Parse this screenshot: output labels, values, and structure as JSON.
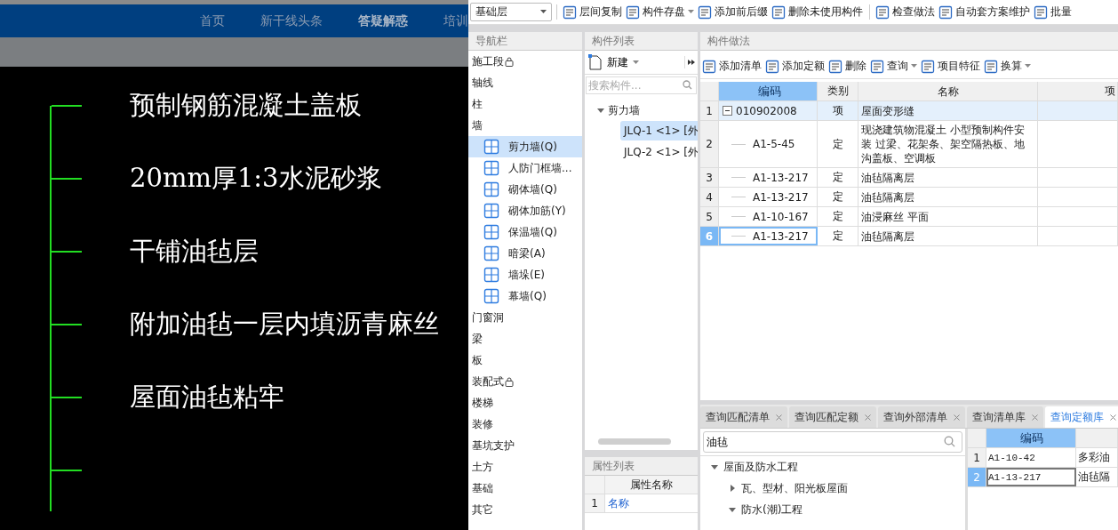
{
  "web_header": {
    "nav_links": [
      {
        "label": "首页",
        "selected": false
      },
      {
        "label": "新干线头条",
        "selected": false
      },
      {
        "label": "答疑解惑",
        "selected": true
      },
      {
        "label": "培训",
        "selected": false
      }
    ]
  },
  "cad_drawing": {
    "labels": [
      "预制钢筋混凝土盖板",
      "20mm厚1:3水泥砂浆",
      "干铺油毡层",
      "附加油毡一层内填沥青麻丝",
      "屋面油毡粘牢"
    ]
  },
  "floor_selector": {
    "value": "基础层"
  },
  "toolbar": [
    {
      "label": "层间复制",
      "has_menu": false,
      "group_start": true
    },
    {
      "label": "构件存盘",
      "has_menu": true,
      "group_start": false
    },
    {
      "label": "添加前后缀",
      "has_menu": false,
      "group_start": false
    },
    {
      "label": "删除未使用构件",
      "has_menu": false,
      "group_start": false
    },
    {
      "label": "检查做法",
      "has_menu": false,
      "group_start": true
    },
    {
      "label": "自动套方案维护",
      "has_menu": false,
      "group_start": false
    },
    {
      "label": "批量",
      "has_menu": false,
      "group_start": false
    }
  ],
  "nav_panel": {
    "title": "导航栏",
    "items": [
      {
        "label": "施工段",
        "locked": true
      },
      {
        "label": "轴线",
        "locked": false
      },
      {
        "label": "柱",
        "locked": false
      },
      {
        "label": "墙",
        "locked": false,
        "children": [
          {
            "label": "剪力墙(Q)",
            "selected": true
          },
          {
            "label": "人防门框墙...",
            "selected": false
          },
          {
            "label": "砌体墙(Q)",
            "selected": false
          },
          {
            "label": "砌体加筋(Y)",
            "selected": false
          },
          {
            "label": "保温墙(Q)",
            "selected": false
          },
          {
            "label": "暗梁(A)",
            "selected": false
          },
          {
            "label": "墙垛(E)",
            "selected": false
          },
          {
            "label": "幕墙(Q)",
            "selected": false
          }
        ]
      },
      {
        "label": "门窗洞",
        "locked": false
      },
      {
        "label": "梁",
        "locked": false
      },
      {
        "label": "板",
        "locked": false
      },
      {
        "label": "装配式",
        "locked": true
      },
      {
        "label": "楼梯",
        "locked": false
      },
      {
        "label": "装修",
        "locked": false
      },
      {
        "label": "基坑支护",
        "locked": false
      },
      {
        "label": "土方",
        "locked": false
      },
      {
        "label": "基础",
        "locked": false
      },
      {
        "label": "其它",
        "locked": false
      }
    ]
  },
  "component_list": {
    "title": "构件列表",
    "new_button": {
      "label": "新建"
    },
    "search": {
      "placeholder": "搜索构件..."
    },
    "tree": [
      {
        "label": "剪力墙",
        "expanded": true,
        "children": [
          {
            "label": "JLQ-1 <1> [外",
            "selected": true
          },
          {
            "label": "JLQ-2 <1> [外",
            "selected": false
          }
        ]
      }
    ]
  },
  "properties_panel": {
    "title": "属性列表",
    "columns": [
      "属性名称"
    ],
    "rows": [
      {
        "index": "1",
        "name": "名称"
      }
    ]
  },
  "methods_panel": {
    "title": "构件做法",
    "toolbar": [
      {
        "label": "添加清单",
        "has_menu": false
      },
      {
        "label": "添加定额",
        "has_menu": false
      },
      {
        "label": "删除",
        "has_menu": false
      },
      {
        "label": "查询",
        "has_menu": true
      },
      {
        "label": "项目特征",
        "has_menu": false
      },
      {
        "label": "换算",
        "has_menu": true
      }
    ],
    "columns": [
      {
        "label": "编码",
        "selected": true
      },
      {
        "label": "类别",
        "selected": false
      },
      {
        "label": "名称",
        "selected": false
      },
      {
        "label": "项",
        "selected": false
      }
    ],
    "rows": [
      {
        "index": "1",
        "kind": "list",
        "expanded": true,
        "highlighted": true,
        "selected": false,
        "code": "010902008",
        "type": "项",
        "name": "屋面变形缝"
      },
      {
        "index": "2",
        "kind": "quota",
        "highlighted": false,
        "selected": false,
        "code": "A1-5-45",
        "type": "定",
        "name": "现浇建筑物混凝土 小型预制构件安装 过梁、花架条、架空隔热板、地沟盖板、空调板"
      },
      {
        "index": "3",
        "kind": "quota",
        "highlighted": false,
        "selected": false,
        "code": "A1-13-217",
        "type": "定",
        "name": "油毡隔离层"
      },
      {
        "index": "4",
        "kind": "quota",
        "highlighted": false,
        "selected": false,
        "code": "A1-13-217",
        "type": "定",
        "name": "油毡隔离层"
      },
      {
        "index": "5",
        "kind": "quota",
        "highlighted": false,
        "selected": false,
        "code": "A1-10-167",
        "type": "定",
        "name": "油浸麻丝 平面"
      },
      {
        "index": "6",
        "kind": "quota",
        "highlighted": false,
        "selected": true,
        "code": "A1-13-217",
        "type": "定",
        "name": "油毡隔离层"
      }
    ]
  },
  "query_panel": {
    "tabs": [
      {
        "label": "查询匹配清单",
        "selected": false
      },
      {
        "label": "查询匹配定额",
        "selected": false
      },
      {
        "label": "查询外部清单",
        "selected": false
      },
      {
        "label": "查询清单库",
        "selected": false
      },
      {
        "label": "查询定额库",
        "selected": true
      }
    ],
    "search": {
      "value": "油毡"
    },
    "tree": [
      {
        "label": "屋面及防水工程",
        "expanded": true,
        "children": [
          {
            "label": "瓦、型材、阳光板屋面",
            "expanded": false
          },
          {
            "label": "防水(潮)工程",
            "expanded": true
          }
        ]
      }
    ],
    "grid": {
      "columns": [
        {
          "label": "编码",
          "selected": true
        }
      ],
      "rows": [
        {
          "index": "1",
          "code": "A1-10-42",
          "name": "多彩油",
          "selected": false
        },
        {
          "index": "2",
          "code": "A1-13-217",
          "name": "油毡隔",
          "selected": true
        }
      ]
    }
  }
}
